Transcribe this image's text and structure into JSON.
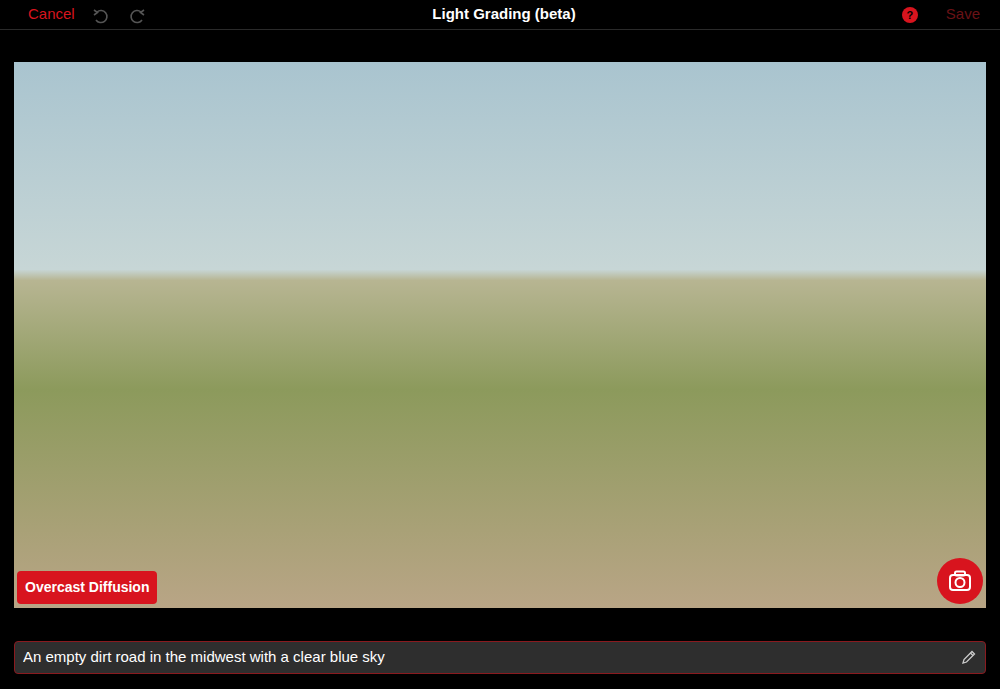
{
  "header": {
    "cancel": "Cancel",
    "undo": {
      "disabled": true
    },
    "redo": {
      "disabled": true
    },
    "title": "Light Grading (beta)",
    "help": "?",
    "save": "Save",
    "save_disabled": true
  },
  "preset": {
    "label": "Overcast Diffusion"
  },
  "prompt": {
    "value": "An empty dirt road in the midwest with a clear blue sky"
  }
}
